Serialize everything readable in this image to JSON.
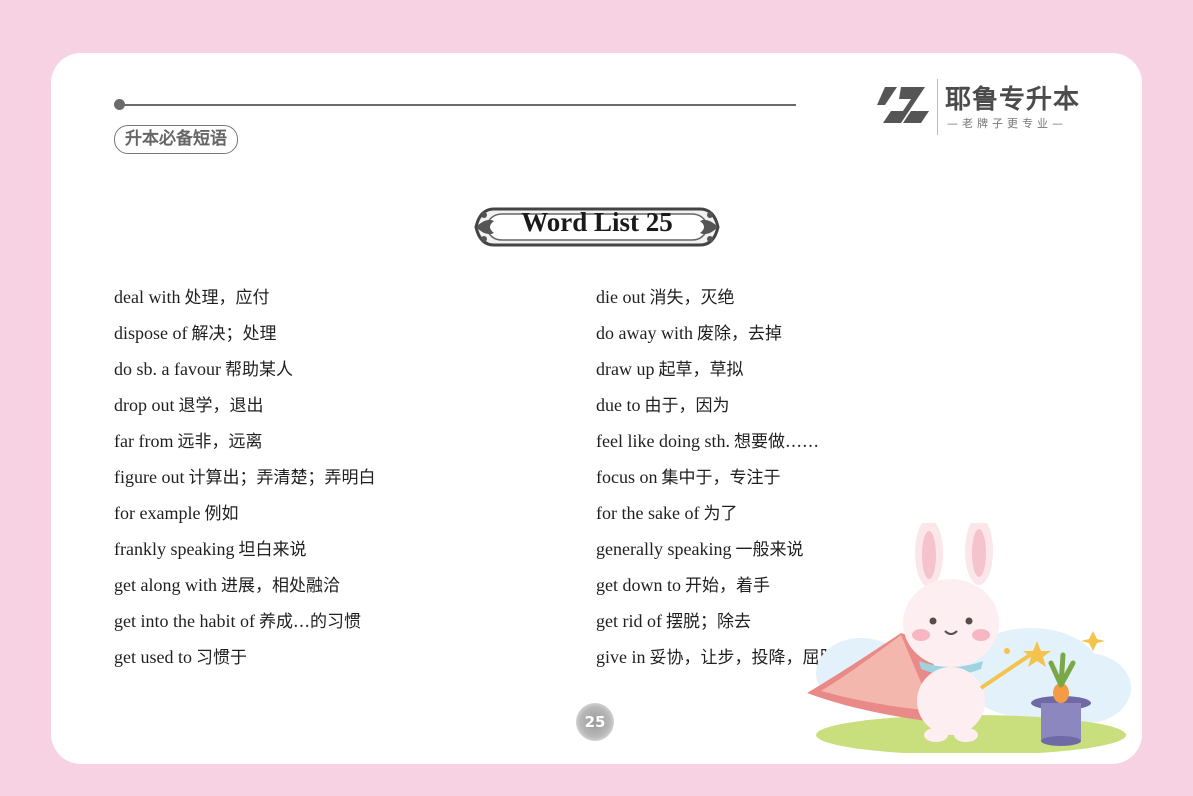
{
  "header": {
    "section_tag": "升本必备短语",
    "logo_name": "耶鲁专升本",
    "logo_slogan": "—老牌子更专业—"
  },
  "title": "Word List 25",
  "left_column": [
    {
      "en": "deal with",
      "zh": "处理，应付"
    },
    {
      "en": "dispose of",
      "zh": "解决；处理"
    },
    {
      "en": "do sb. a favour",
      "zh": "帮助某人"
    },
    {
      "en": "drop out",
      "zh": "退学，退出"
    },
    {
      "en": "far from",
      "zh": "远非，远离"
    },
    {
      "en": "figure out",
      "zh": "计算出；弄清楚；弄明白"
    },
    {
      "en": "for example",
      "zh": "例如"
    },
    {
      "en": "frankly speaking",
      "zh": "坦白来说"
    },
    {
      "en": "get along with",
      "zh": "进展，相处融洽"
    },
    {
      "en": "get into the habit of",
      "zh": "养成…的习惯"
    },
    {
      "en": "get used to",
      "zh": "习惯于"
    }
  ],
  "right_column": [
    {
      "en": "die out",
      "zh": "消失，灭绝"
    },
    {
      "en": "do away with",
      "zh": "废除，去掉"
    },
    {
      "en": "draw up",
      "zh": "起草，草拟"
    },
    {
      "en": "due to",
      "zh": "由于，因为"
    },
    {
      "en": "feel like doing sth.",
      "zh": "想要做……"
    },
    {
      "en": "focus on",
      "zh": "集中于，专注于"
    },
    {
      "en": "for the sake of",
      "zh": "为了"
    },
    {
      "en": "generally speaking",
      "zh": "一般来说"
    },
    {
      "en": "get down to",
      "zh": "开始，着手"
    },
    {
      "en": "get rid of",
      "zh": "摆脱；除去"
    },
    {
      "en": "give in",
      "zh": "妥协，让步，投降，屈服"
    }
  ],
  "page_number": "25",
  "colors": {
    "background": "#f6d2e2",
    "page": "#ffffff",
    "accent_gray": "#6b6b6b"
  },
  "icons": {
    "logo_mark": "yale-logo-icon",
    "illustration": "bunny-magician-illustration"
  }
}
